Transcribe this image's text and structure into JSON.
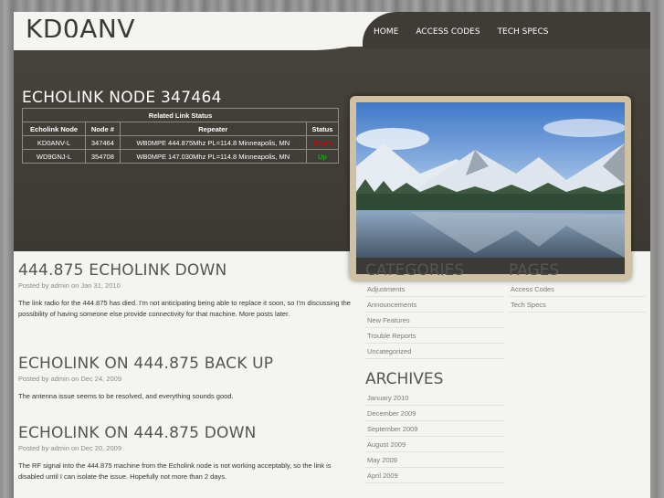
{
  "site": {
    "title": "KD0ANV"
  },
  "nav": [
    {
      "label": "HOME"
    },
    {
      "label": "ACCESS CODES"
    },
    {
      "label": "TECH SPECS"
    }
  ],
  "hero": {
    "title": "ECHOLINK NODE 347464",
    "table": {
      "caption": "Related Link Status",
      "headers": [
        "Echolink Node",
        "Node #",
        "Repeater",
        "Status"
      ],
      "rows": [
        {
          "node": "KD0ANV-L",
          "num": "347464",
          "repeater": "WB0MPE 444.875Mhz PL=114.8 Minneapolis, MN",
          "status": "Down"
        },
        {
          "node": "WD9GNJ-L",
          "num": "354708",
          "repeater": "WB0MPE 147.030Mhz PL=114.8 Minneapolis, MN",
          "status": "Up"
        }
      ]
    }
  },
  "posts": [
    {
      "title": "444.875 ECHOLINK DOWN",
      "meta": "Posted by admin on Jan 31, 2010",
      "body": "The link radio for the 444.875 has died. I'm not anticipating being able to replace it soon, so I'm discussing the possibility of having someone else provide connectivity for that machine. More posts later."
    },
    {
      "title": "ECHOLINK ON 444.875 BACK UP",
      "meta": "Posted by admin on Dec 24, 2009",
      "body": "The antenna issue seems to be resolved, and everything sounds good."
    },
    {
      "title": "ECHOLINK ON 444.875 DOWN",
      "meta": "Posted by admin on Dec 20, 2009",
      "body": "The RF signal into the 444.875 machine from the Echolink node is not working acceptably, so the link is disabled until I can isolate the issue. Hopefully not more than 2 days."
    }
  ],
  "categories": {
    "title": "CATEGORIES",
    "items": [
      "Adjustments",
      "Announcements",
      "New Features",
      "Trouble Reports",
      "Uncategorized"
    ]
  },
  "archives": {
    "title": "ARCHIVES",
    "items": [
      "January 2010",
      "December 2009",
      "September 2009",
      "August 2009",
      "May 2009",
      "April 2009"
    ]
  },
  "pages": {
    "title": "PAGES",
    "items": [
      "Access Codes",
      "Tech Specs"
    ]
  },
  "colors": {
    "nav_bg": "#3f3b36",
    "status_down": "#e00000",
    "status_up": "#1aa81a"
  }
}
